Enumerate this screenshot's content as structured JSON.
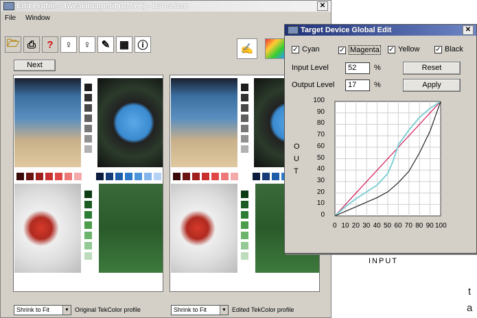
{
  "main_window": {
    "title": "Edit Profile - TweakImage.tif (CMYK) - b3d-3.icm",
    "menu": [
      "File",
      "Window"
    ],
    "toolbar_icons": [
      "folder-open-icon",
      "printer-icon",
      "help-icon",
      "pin-icon",
      "pin-outline-icon",
      "eyedropper-icon",
      "grid-icon",
      "info-icon"
    ],
    "next_label": "Next",
    "left_pane": {
      "fit_select": "Shrink to Fit",
      "caption": "Original TekColor profile"
    },
    "right_pane": {
      "fit_select": "Shrink to Fit",
      "caption": "Edited TekColor profile"
    }
  },
  "dialog": {
    "title": "Target Device Global Edit",
    "channels": [
      {
        "label": "Cyan",
        "checked": true
      },
      {
        "label": "Magenta",
        "checked": true
      },
      {
        "label": "Yellow",
        "checked": true
      },
      {
        "label": "Black",
        "checked": true
      }
    ],
    "input_level_label": "Input Level",
    "input_level": "52",
    "output_level_label": "Output Level",
    "output_level": "17",
    "percent": "%",
    "reset_label": "Reset",
    "apply_label": "Apply",
    "y_axis_letters": [
      "O",
      "U",
      "T"
    ],
    "x_axis_label": "INPUT"
  },
  "chart_data": {
    "type": "line",
    "xlim": [
      0,
      100
    ],
    "ylim": [
      0,
      100
    ],
    "x_ticks": [
      0,
      10,
      20,
      30,
      40,
      50,
      60,
      70,
      80,
      90,
      100
    ],
    "y_ticks": [
      0,
      10,
      20,
      30,
      40,
      50,
      60,
      70,
      80,
      90,
      100
    ],
    "grid": true,
    "series": [
      {
        "color": "#d0165c",
        "x": [
          0,
          100
        ],
        "y": [
          0,
          100
        ]
      },
      {
        "color": "#7fd0d4",
        "x": [
          0,
          10,
          20,
          30,
          40,
          50,
          55,
          60,
          70,
          80,
          90,
          100
        ],
        "y": [
          0,
          8,
          15,
          21,
          27,
          37,
          48,
          62,
          75,
          86,
          94,
          100
        ]
      },
      {
        "color": "#222222",
        "x": [
          0,
          10,
          20,
          30,
          40,
          50,
          60,
          70,
          80,
          90,
          100
        ],
        "y": [
          0,
          4,
          8,
          12,
          16,
          21,
          29,
          39,
          55,
          74,
          100
        ]
      }
    ]
  },
  "page_fragments": [
    "t",
    "a"
  ],
  "colors": {
    "window_bg": "#d4d0c8",
    "dialog_title": "#1d2f7a"
  },
  "swatch_colors": {
    "gray": [
      "#1c1c1c",
      "#303030",
      "#484848",
      "#5e5e5e",
      "#777",
      "#919191",
      "#b1b1b1"
    ],
    "red": [
      "#3a0a0a",
      "#6b1414",
      "#a02020",
      "#c83030",
      "#e04848",
      "#ec7878",
      "#f4aaaa"
    ],
    "blue": [
      "#0c1c3c",
      "#163c78",
      "#1d5ca8",
      "#2c78c8",
      "#4c94dc",
      "#84b4ec",
      "#b4d2f4"
    ],
    "green": [
      "#0c3c14",
      "#1c5c24",
      "#2c7c34",
      "#4c9c4c",
      "#6cb46c",
      "#94c894",
      "#bcdcbc"
    ]
  }
}
